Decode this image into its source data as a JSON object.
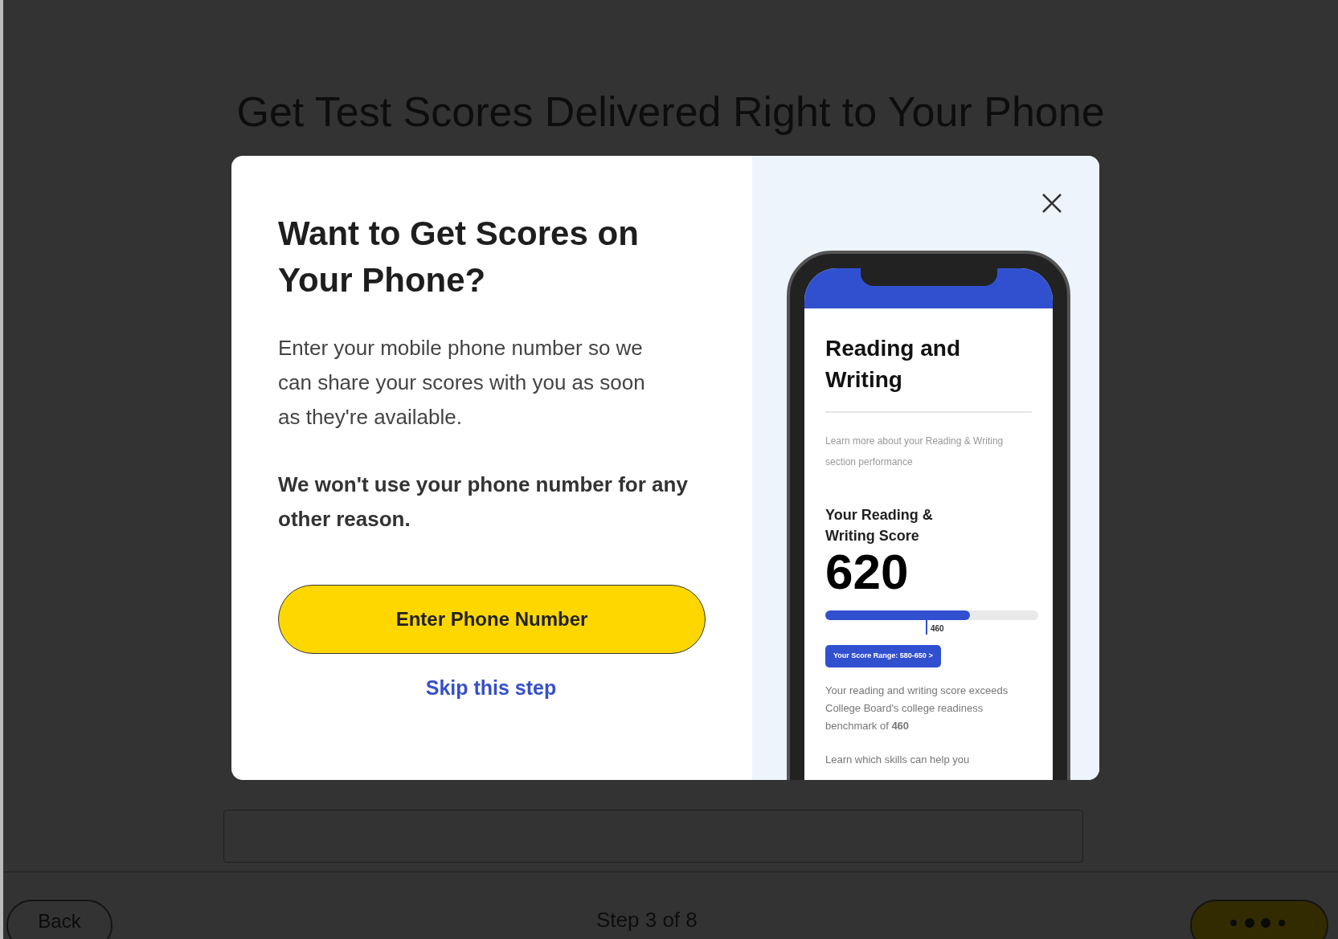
{
  "page": {
    "title": "Get Test Scores Delivered Right to Your Phone",
    "footer": {
      "back": "Back",
      "step": "Step 3 of 8"
    }
  },
  "modal": {
    "heading": "Want to Get Scores on Your Phone?",
    "body": "Enter your mobile phone number so we can share your scores with you as soon as they're available.",
    "note": "We won't use your phone number for any other reason.",
    "primary_button": "Enter Phone Number",
    "skip_link": "Skip this step",
    "phone_screen": {
      "title": "Reading and Writing",
      "subtitle": "Learn more about your Reading & Writing section performance",
      "score_label": "Your Reading & Writing Score",
      "score": "620",
      "meter": {
        "level": 0.68
      },
      "benchmark_marker": "460",
      "range_button": "Your Score Range: 580-650 >",
      "description": "Your reading and writing score exceeds College Board's college readiness benchmark of **460**",
      "more": "Learn which skills can help you"
    }
  }
}
